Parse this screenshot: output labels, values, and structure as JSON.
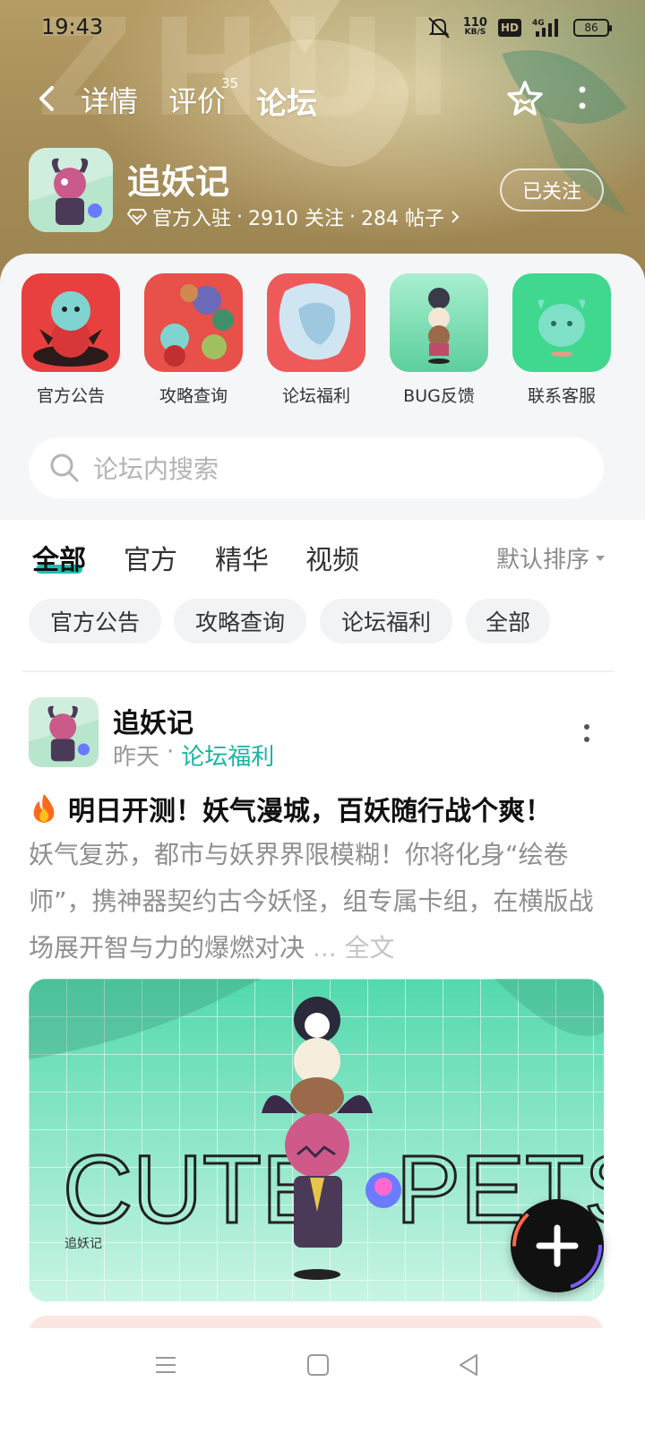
{
  "status_bar": {
    "time": "19:43",
    "net_speed_value": "110",
    "net_speed_unit": "KB/S",
    "hd_label": "HD",
    "network": "4G",
    "battery": "86"
  },
  "top_nav": {
    "tabs": [
      {
        "label": "详情"
      },
      {
        "label": "评价",
        "badge": "35"
      },
      {
        "label": "论坛",
        "active": true
      }
    ]
  },
  "app": {
    "name": "追妖记",
    "official_label": "官方入驻",
    "followers": "2910 关注",
    "posts": "284 帖子",
    "follow_button": "已关注"
  },
  "shortcuts": [
    {
      "label": "官方公告"
    },
    {
      "label": "攻略查询"
    },
    {
      "label": "论坛福利"
    },
    {
      "label": "BUG反馈"
    },
    {
      "label": "联系客服"
    }
  ],
  "search": {
    "placeholder": "论坛内搜索"
  },
  "filter_tabs": [
    {
      "label": "全部",
      "active": true
    },
    {
      "label": "官方"
    },
    {
      "label": "精华"
    },
    {
      "label": "视频"
    }
  ],
  "sort_label": "默认排序",
  "chips": [
    {
      "label": "官方公告"
    },
    {
      "label": "攻略查询"
    },
    {
      "label": "论坛福利"
    },
    {
      "label": "全部"
    }
  ],
  "post": {
    "author": "追妖记",
    "time": "昨天",
    "separator": "·",
    "category": "论坛福利",
    "title": "明日开测！妖气漫城，百妖随行战个爽！",
    "body": "妖气复苏，都市与妖界界限模糊！你将化身“绘卷师”，携神器契约古今妖怪，组专属卡组，在横版战场展开智与力的爆燃对决",
    "more_ellipsis": "...",
    "more_label": "全文",
    "image_text_left": "CUTE",
    "image_text_right": "PETS",
    "image_logo": "追妖记"
  },
  "colors": {
    "accent": "#19c2b2",
    "hero_bg": "#a68d59",
    "panel_bg": "#f5f6f8"
  }
}
